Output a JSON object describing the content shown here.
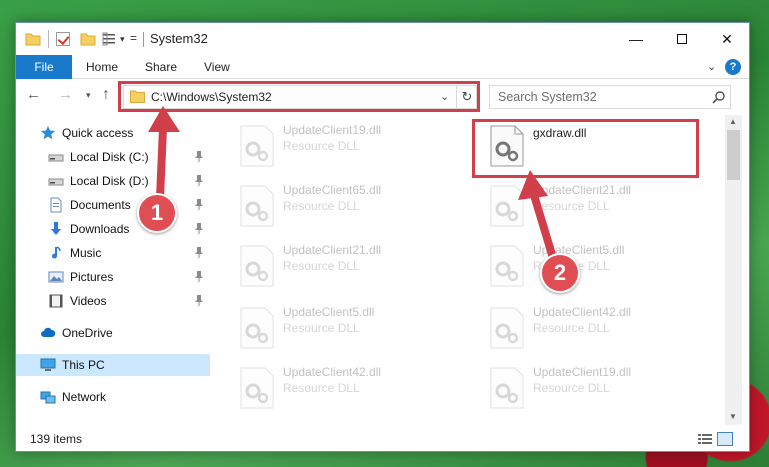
{
  "window": {
    "title": "System32",
    "controls": {
      "minimize": "—",
      "close": "✕"
    }
  },
  "quick_access_toolbar": {
    "customize_glyph": "▾",
    "customize_eq": "="
  },
  "ribbon": {
    "tabs": [
      "File",
      "Home",
      "Share",
      "View"
    ],
    "chevron": "⌄",
    "help": "?"
  },
  "navigation": {
    "back": "←",
    "forward": "→",
    "recent": "▾",
    "up": "↑",
    "address": "C:\\Windows\\System32",
    "address_dropdown": "⌄",
    "refresh": "↻",
    "search_placeholder": "Search System32"
  },
  "sidebar": {
    "items": [
      {
        "label": "Quick access",
        "icon": "star-icon",
        "pinned": false
      },
      {
        "label": "Local Disk (C:)",
        "icon": "drive-icon",
        "pinned": true
      },
      {
        "label": "Local Disk (D:)",
        "icon": "drive-icon",
        "pinned": true
      },
      {
        "label": "Documents",
        "icon": "documents-icon",
        "pinned": true
      },
      {
        "label": "Downloads",
        "icon": "downloads-icon",
        "pinned": true
      },
      {
        "label": "Music",
        "icon": "music-icon",
        "pinned": true
      },
      {
        "label": "Pictures",
        "icon": "pictures-icon",
        "pinned": true
      },
      {
        "label": "Videos",
        "icon": "videos-icon",
        "pinned": true
      },
      {
        "label": "OneDrive",
        "icon": "onedrive-icon",
        "pinned": false
      },
      {
        "label": "This PC",
        "icon": "this-pc-icon",
        "pinned": false,
        "selected": true
      },
      {
        "label": "Network",
        "icon": "network-icon",
        "pinned": false
      }
    ]
  },
  "files": {
    "left_column": [
      {
        "name": "UpdateClient19.dll",
        "type": "Resource DLL"
      },
      {
        "name": "UpdateClient65.dll",
        "type": "Resource DLL"
      },
      {
        "name": "UpdateClient21.dll",
        "type": "Resource DLL"
      },
      {
        "name": "UpdateClient5.dll",
        "type": "Resource DLL"
      },
      {
        "name": "UpdateClient42.dll",
        "type": "Resource DLL"
      }
    ],
    "right_column": [
      {
        "name": "gxdraw.dll",
        "type": "",
        "highlighted": true
      },
      {
        "name": "UpdateClient21.dll",
        "type": "Resource DLL"
      },
      {
        "name": "UpdateClient5.dll",
        "type": "Resource DLL"
      },
      {
        "name": "UpdateClient42.dll",
        "type": "Resource DLL"
      },
      {
        "name": "UpdateClient19.dll",
        "type": "Resource DLL"
      }
    ]
  },
  "scrollbar": {
    "up": "▲",
    "down": "▼"
  },
  "status": {
    "item_count": "139 items"
  },
  "annotations": {
    "step1": "1",
    "step2": "2",
    "color": "#d13f4a"
  }
}
